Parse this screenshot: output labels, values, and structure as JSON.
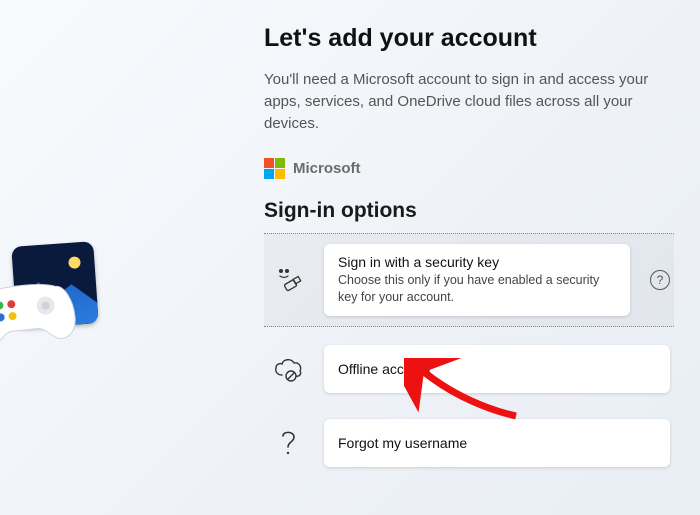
{
  "heading": "Let's add your account",
  "subtitle": "You'll need a Microsoft account to sign in and access your apps, services, and OneDrive cloud files across all your devices.",
  "brand": "Microsoft",
  "section": "Sign-in options",
  "options": {
    "security_key": {
      "title": "Sign in with a security key",
      "desc": "Choose this only if you have enabled a security key for your account."
    },
    "offline": {
      "title": "Offline account"
    },
    "forgot": {
      "title": "Forgot my username"
    }
  },
  "help": "?"
}
